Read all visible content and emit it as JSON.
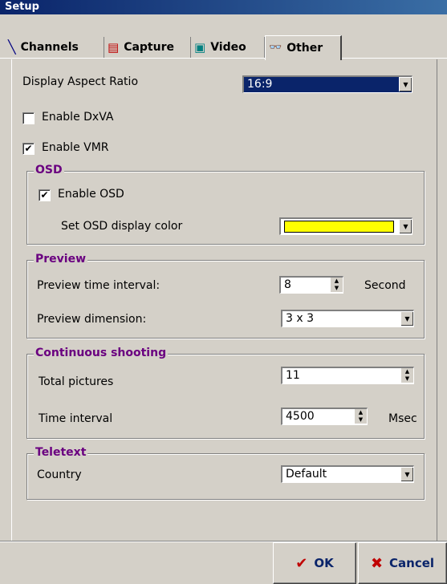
{
  "window": {
    "title": "Setup"
  },
  "tabs": [
    {
      "label": "Channels",
      "icon": "satellite-dish-icon"
    },
    {
      "label": "Capture",
      "icon": "capture-card-icon"
    },
    {
      "label": "Video",
      "icon": "tv-icon"
    },
    {
      "label": "Other",
      "icon": "glasses-icon",
      "active": true
    }
  ],
  "display_aspect": {
    "label": "Display Aspect Ratio",
    "value": "16:9"
  },
  "enable_dxva": {
    "label": "Enable DxVA",
    "checked": false
  },
  "enable_vmr": {
    "label": "Enable VMR",
    "checked": true
  },
  "osd": {
    "title": "OSD",
    "enable": {
      "label": "Enable OSD",
      "checked": true
    },
    "color_label": "Set OSD display color",
    "color": "#ffff00"
  },
  "preview": {
    "title": "Preview",
    "interval_label": "Preview time interval:",
    "interval_value": "8",
    "interval_unit": "Second",
    "dimension_label": "Preview dimension:",
    "dimension_value": "3 x 3"
  },
  "continuous": {
    "title": "Continuous shooting",
    "total_label": "Total pictures",
    "total_value": "11",
    "interval_label": "Time interval",
    "interval_value": "4500",
    "interval_unit": "Msec"
  },
  "teletext": {
    "title": "Teletext",
    "country_label": "Country",
    "country_value": "Default"
  },
  "buttons": {
    "ok": "OK",
    "cancel": "Cancel"
  }
}
